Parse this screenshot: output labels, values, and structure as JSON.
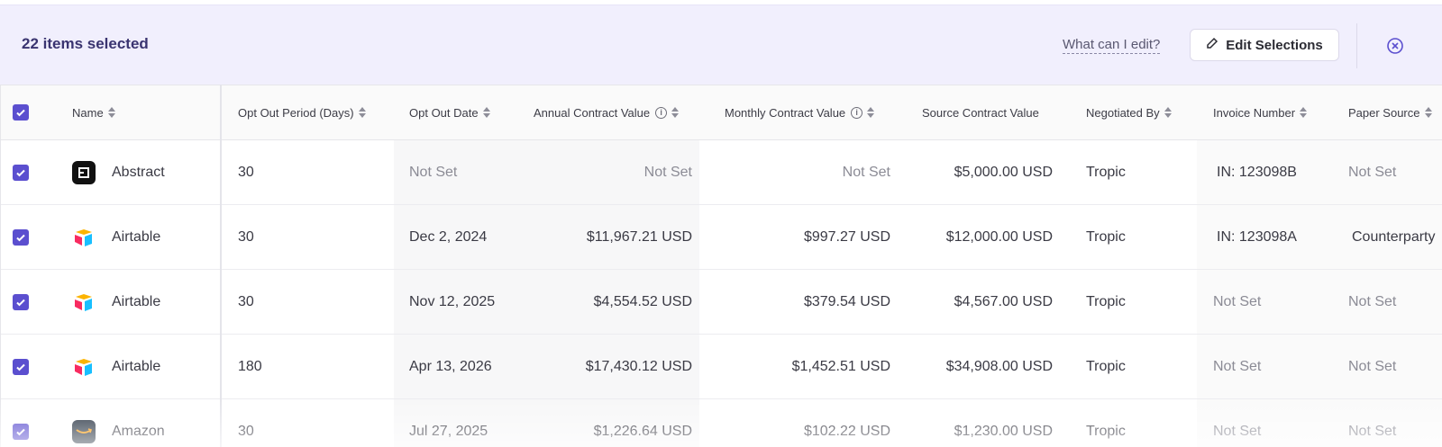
{
  "banner": {
    "selected_count_text": "22 items selected",
    "help_link": "What can I edit?",
    "edit_button_label": "Edit Selections"
  },
  "table": {
    "columns": {
      "name": "Name",
      "opt_out_period": "Opt Out Period (Days)",
      "opt_out_date": "Opt Out Date",
      "annual_value": "Annual Contract Value",
      "monthly_value": "Monthly Contract Value",
      "source_value": "Source Contract Value",
      "negotiated_by": "Negotiated By",
      "invoice_number": "Invoice Number",
      "paper_source": "Paper Source"
    },
    "rows": [
      {
        "name": "Abstract",
        "logo": "abstract-logo",
        "opt_out_period": "30",
        "opt_out_date": "Not Set",
        "annual_value": "Not Set",
        "monthly_value": "Not Set",
        "source_value": "$5,000.00 USD",
        "negotiated_by": "Tropic",
        "invoice_number": "IN: 123098B",
        "paper_source": "Not Set"
      },
      {
        "name": "Airtable",
        "logo": "airtable-logo",
        "opt_out_period": "30",
        "opt_out_date": "Dec 2, 2024",
        "annual_value": "$11,967.21 USD",
        "monthly_value": "$997.27 USD",
        "source_value": "$12,000.00 USD",
        "negotiated_by": "Tropic",
        "invoice_number": "IN: 123098A",
        "paper_source": "Counterparty"
      },
      {
        "name": "Airtable",
        "logo": "airtable-logo",
        "opt_out_period": "30",
        "opt_out_date": "Nov 12, 2025",
        "annual_value": "$4,554.52 USD",
        "monthly_value": "$379.54 USD",
        "source_value": "$4,567.00 USD",
        "negotiated_by": "Tropic",
        "invoice_number": "Not Set",
        "paper_source": "Not Set"
      },
      {
        "name": "Airtable",
        "logo": "airtable-logo",
        "opt_out_period": "180",
        "opt_out_date": "Apr 13, 2026",
        "annual_value": "$17,430.12 USD",
        "monthly_value": "$1,452.51 USD",
        "source_value": "$34,908.00 USD",
        "negotiated_by": "Tropic",
        "invoice_number": "Not Set",
        "paper_source": "Not Set"
      },
      {
        "name": "Amazon",
        "logo": "amazon-logo",
        "opt_out_period": "30",
        "opt_out_date": "Jul 27, 2025",
        "annual_value": "$1,226.64 USD",
        "monthly_value": "$102.22 USD",
        "source_value": "$1,230.00 USD",
        "negotiated_by": "Tropic",
        "invoice_number": "Not Set",
        "paper_source": "Not Set"
      }
    ]
  },
  "colors": {
    "accent": "#5b4fcf",
    "banner_bg": "#f1effd"
  }
}
